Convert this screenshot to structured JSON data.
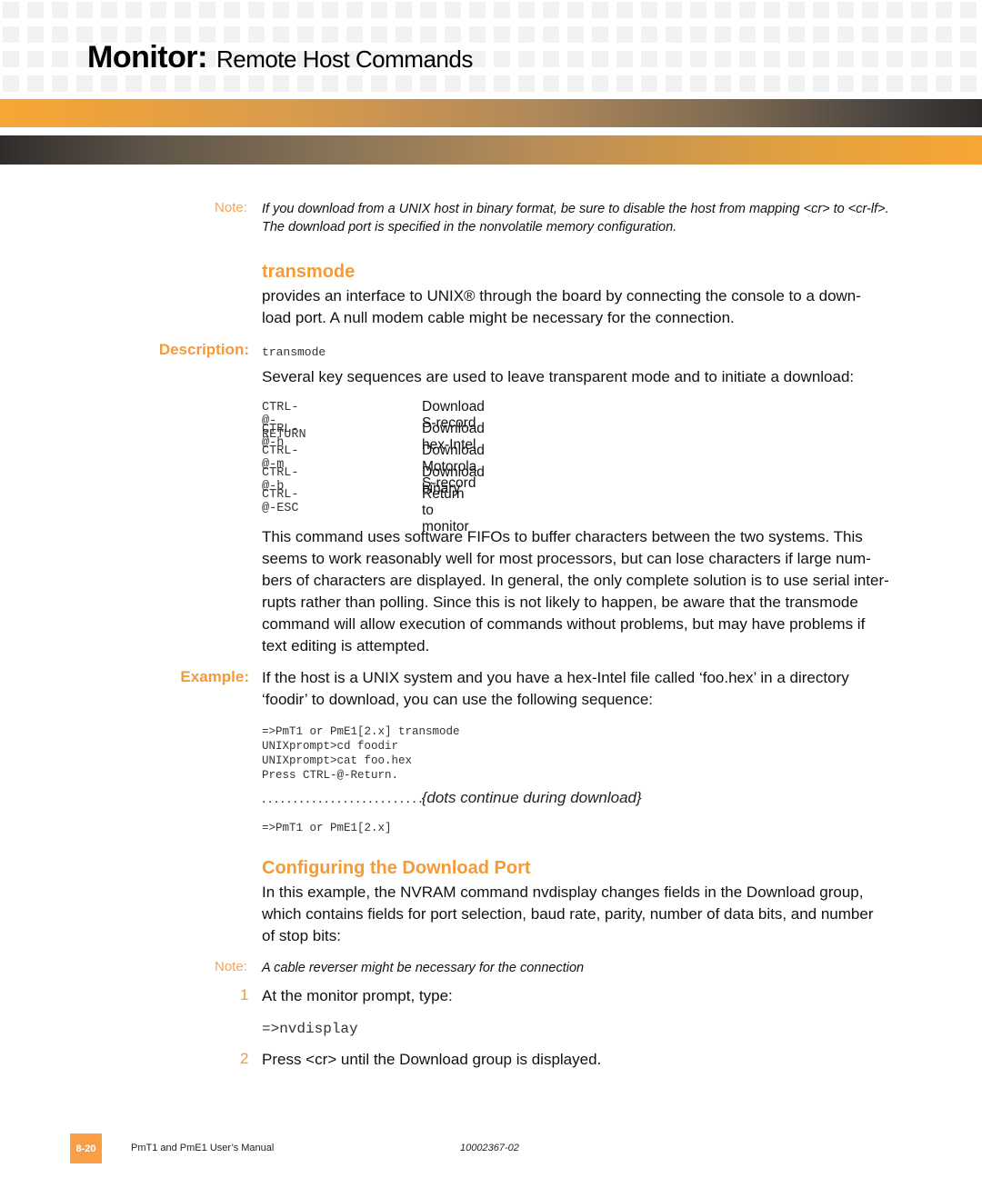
{
  "header": {
    "title_bold": "Monitor:",
    "title_rest": "Remote Host Commands"
  },
  "note1": {
    "label": "Note:",
    "lines": [
      "If you download from a UNIX host in binary format, be sure to disable the host from mapping <cr> to <cr-lf>.",
      "The download port is specified in the nonvolatile memory configuration."
    ]
  },
  "transmode": {
    "heading": "transmode",
    "intro_lines": [
      "provides an interface to UNIX® through the board by connecting the console to a down-",
      "load port. A null modem cable might be necessary for the connection."
    ],
    "description_label": "Description:",
    "syntax": "transmode",
    "keys_intro": "Several key sequences are used to leave transparent mode and to initiate a download:",
    "keys": [
      {
        "key": "CTRL-@-RETURN",
        "action": "Download S-record"
      },
      {
        "key": "CTRL-@-h",
        "action": "Download hex-Intel"
      },
      {
        "key": "CTRL-@-m",
        "action": "Download Motorola S-record"
      },
      {
        "key": "CTRL-@-b",
        "action": "Download binary"
      },
      {
        "key": "CTRL-@-ESC",
        "action": "Return to monitor"
      }
    ],
    "fifo_lines": [
      "This command uses software FIFOs to buffer characters between the two systems. This",
      "seems to work reasonably well for most processors, but can lose characters if large num-",
      "bers of characters are displayed. In general, the only complete solution is to use serial inter-",
      "rupts rather than polling. Since this is not likely to happen, be aware that the transmode",
      "command will allow execution of commands without problems, but may have problems if",
      "text editing is attempted."
    ]
  },
  "example": {
    "label": "Example:",
    "lines": [
      "If the host is a UNIX system and you have a hex-Intel file called ‘foo.hex’ in a directory",
      "‘foodir’ to download, you can use the following sequence:"
    ],
    "code": [
      "=>PmT1 or PmE1[2.x] transmode",
      "UNIXprompt>cd foodir",
      "UNIXprompt>cat foo.hex",
      "Press CTRL-@-Return."
    ],
    "dots": ". . . . . . . . . . . . . . . . . . . . . . . . . .",
    "dots_note": "{dots continue during download}",
    "final_prompt": "=>PmT1 or PmE1[2.x]"
  },
  "configuring": {
    "heading": "Configuring the Download Port",
    "lines": [
      "In this example, the NVRAM command nvdisplay changes fields in the Download group,",
      "which contains fields for port selection, baud rate, parity, number of data bits, and number",
      "of stop bits:"
    ],
    "note_label": "Note:",
    "note_text": "A cable reverser might be necessary for the connection",
    "steps": [
      {
        "num": "1",
        "text": "At the monitor prompt, type:"
      },
      {
        "num": "2",
        "text": "Press <cr> until the Download group is displayed."
      }
    ],
    "command": "=>nvdisplay"
  },
  "footer": {
    "page": "8-20",
    "manual": "PmT1 and PmE1 User’s Manual",
    "doc_number": "10002367-02"
  }
}
